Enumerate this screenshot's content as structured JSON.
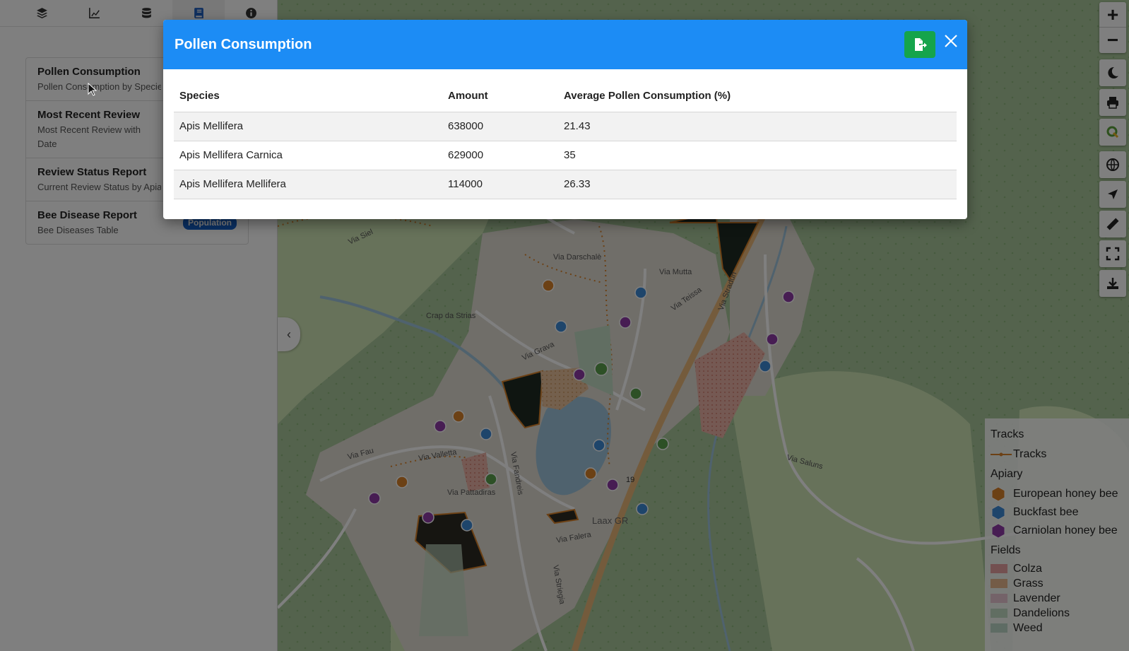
{
  "sidebar": {
    "tabs": [
      {
        "name": "layers",
        "icon": "layers-icon",
        "active": false
      },
      {
        "name": "chart",
        "icon": "chart-line-icon",
        "active": false
      },
      {
        "name": "database",
        "icon": "database-icon",
        "active": false
      },
      {
        "name": "reports",
        "icon": "book-icon",
        "active": true
      },
      {
        "name": "info",
        "icon": "info-icon",
        "active": false
      }
    ],
    "reports": [
      {
        "title": "Pollen Consumption",
        "subtitle": "Pollen Consumption by Species"
      },
      {
        "title": "Most Recent Review",
        "subtitle": "Most Recent Review with Date"
      },
      {
        "title": "Review Status Report",
        "subtitle": "Current Review Status by Apiary"
      },
      {
        "title": "Bee Disease Report",
        "subtitle": "Bee Diseases Table",
        "badge": "Population"
      }
    ]
  },
  "modal": {
    "title": "Pollen Consumption",
    "export_icon": "file-export-icon",
    "close_icon": "close-icon",
    "columns": [
      "Species",
      "Amount",
      "Average Pollen Consumption (%)"
    ],
    "rows": [
      [
        "Apis Mellifera",
        "638000",
        "21.43"
      ],
      [
        "Apis Mellifera Carnica",
        "629000",
        "35"
      ],
      [
        "Apis Mellifera Mellifera",
        "114000",
        "26.33"
      ]
    ]
  },
  "map_controls": {
    "zoom_in": "+",
    "zoom_out": "−",
    "buttons": [
      "dark-mode-icon",
      "print-icon",
      "qgis-icon",
      "globe-icon",
      "locate-icon",
      "measure-icon",
      "fullscreen-icon",
      "download-icon"
    ]
  },
  "map_labels": [
    "Via Siel",
    "Via Darschalè",
    "Via Mutta",
    "Via Teissa",
    "Via Grava",
    "Crap da Strias",
    "Via Fau",
    "Via Valletta",
    "Via Pattadiras",
    "Via Falera",
    "Via Fandreis",
    "Via Saluns",
    "Via Stradun",
    "Via Striegia",
    "19",
    "Laax GR"
  ],
  "legend": {
    "tracks_heading": "Tracks",
    "tracks_item": "Tracks",
    "apiary_heading": "Apiary",
    "apiary_items": [
      {
        "label": "European honey bee",
        "color": "#d9822b"
      },
      {
        "label": "Buckfast bee",
        "color": "#3d8bd6"
      },
      {
        "label": "Carniolan honey bee",
        "color": "#8e3aa6"
      }
    ],
    "fields_heading": "Fields",
    "field_items": [
      {
        "label": "Colza",
        "color": "#e7a0a0"
      },
      {
        "label": "Grass",
        "color": "#e8b98e"
      },
      {
        "label": "Lavender",
        "color": "#e9c7d3"
      },
      {
        "label": "Dandelions",
        "color": "#c3dcc4"
      },
      {
        "label": "Weed",
        "color": "#bcd9c8"
      }
    ]
  }
}
